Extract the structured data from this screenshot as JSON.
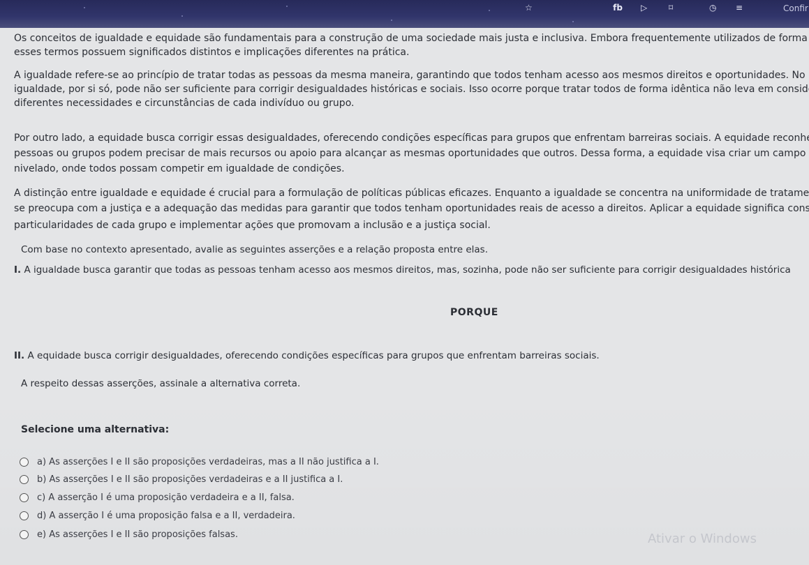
{
  "topbar": {
    "icons": [
      "fb-icon",
      "video-icon",
      "bookmark-icon",
      "timer-icon",
      "menu-music-icon"
    ],
    "label": "Confir"
  },
  "passage": [
    {
      "line1": "Os conceitos de igualdade e equidade são fundamentais para a construção de uma sociedade mais justa e inclusiva. Embora frequentemente utilizados de forma",
      "line2": "esses termos possuem significados distintos e implicações diferentes na prática."
    },
    {
      "line1": "A igualdade refere-se ao princípio de tratar todas as pessoas da mesma maneira, garantindo que todos tenham acesso aos mesmos direitos e oportunidades. No",
      "line2": "igualdade, por si só, pode não ser suficiente para corrigir desigualdades históricas e sociais. Isso ocorre porque tratar todos de forma idêntica não leva em conside",
      "line3": "diferentes necessidades e circunstâncias de cada indivíduo ou grupo."
    },
    {
      "line1": "Por outro lado, a equidade busca corrigir essas desigualdades, oferecendo condições específicas para grupos que enfrentam barreiras sociais. A equidade reconhe",
      "line2": "pessoas ou grupos podem precisar de mais recursos ou apoio para alcançar as mesmas oportunidades que outros. Dessa forma, a equidade visa criar um campo",
      "line3": "nivelado, onde todos possam competir em igualdade de condições."
    },
    {
      "line1": "A distinção entre igualdade e equidade é crucial para a formulação de políticas públicas eficazes. Enquanto a igualdade se concentra na uniformidade de tratamen",
      "line2": "se preocupa com a justiça e a adequação das medidas para garantir que todos tenham oportunidades reais de acesso a direitos. Aplicar a equidade significa consid",
      "line3": "particularidades de cada grupo e implementar ações que promovam a inclusão e a justiça social."
    }
  ],
  "question": {
    "intro": "Com base no contexto apresentado, avalie as seguintes asserções e a relação proposta entre elas.",
    "assertion1_num": "I.",
    "assertion1": "A igualdade busca garantir que todas as pessoas tenham acesso aos mesmos direitos, mas, sozinha, pode não ser suficiente para corrigir desigualdades histórica",
    "connector": "PORQUE",
    "assertion2_num": "II.",
    "assertion2": "A equidade busca corrigir desigualdades, oferecendo condições específicas para grupos que enfrentam barreiras sociais.",
    "prompt": "A respeito dessas asserções, assinale a alternativa correta."
  },
  "options_heading": "Selecione uma alternativa:",
  "options": [
    "a) As asserções I e II são proposições verdadeiras, mas a II não justifica a I.",
    "b) As asserções I e II são proposições verdadeiras e a II justifica a I.",
    "c) A asserção I é uma proposição verdadeira e a II, falsa.",
    "d) A asserção I é uma proposição falsa e a II, verdadeira.",
    "e) As asserções I e II são proposições falsas."
  ],
  "watermark": {
    "title": "Ativar o Windows"
  }
}
